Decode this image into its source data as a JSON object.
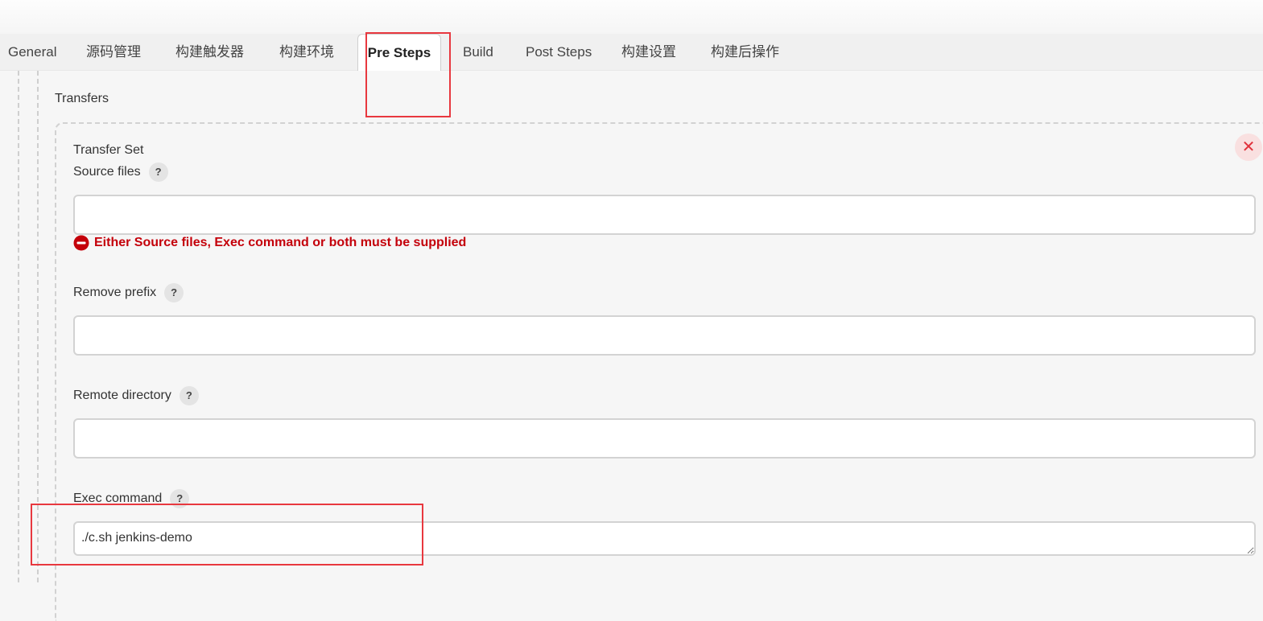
{
  "tabs": [
    {
      "label": "General"
    },
    {
      "label": "源码管理"
    },
    {
      "label": "构建触发器"
    },
    {
      "label": "构建环境"
    },
    {
      "label": "Pre Steps"
    },
    {
      "label": "Build"
    },
    {
      "label": "Post Steps"
    },
    {
      "label": "构建设置"
    },
    {
      "label": "构建后操作"
    }
  ],
  "active_tab": "Pre Steps",
  "transfers": {
    "label": "Transfers",
    "set_title": "Transfer Set",
    "close_symbol": "✕",
    "help_symbol": "?",
    "source_files": {
      "label": "Source files",
      "value": ""
    },
    "error": "Either Source files, Exec command or both must be supplied",
    "remove_prefix": {
      "label": "Remove prefix",
      "value": ""
    },
    "remote_directory": {
      "label": "Remote directory",
      "value": ""
    },
    "exec_command": {
      "label": "Exec command",
      "value": "./c.sh jenkins-demo"
    }
  },
  "colors": {
    "error": "#c4000a",
    "highlight": "#e8383f",
    "close": "#e0313b"
  }
}
